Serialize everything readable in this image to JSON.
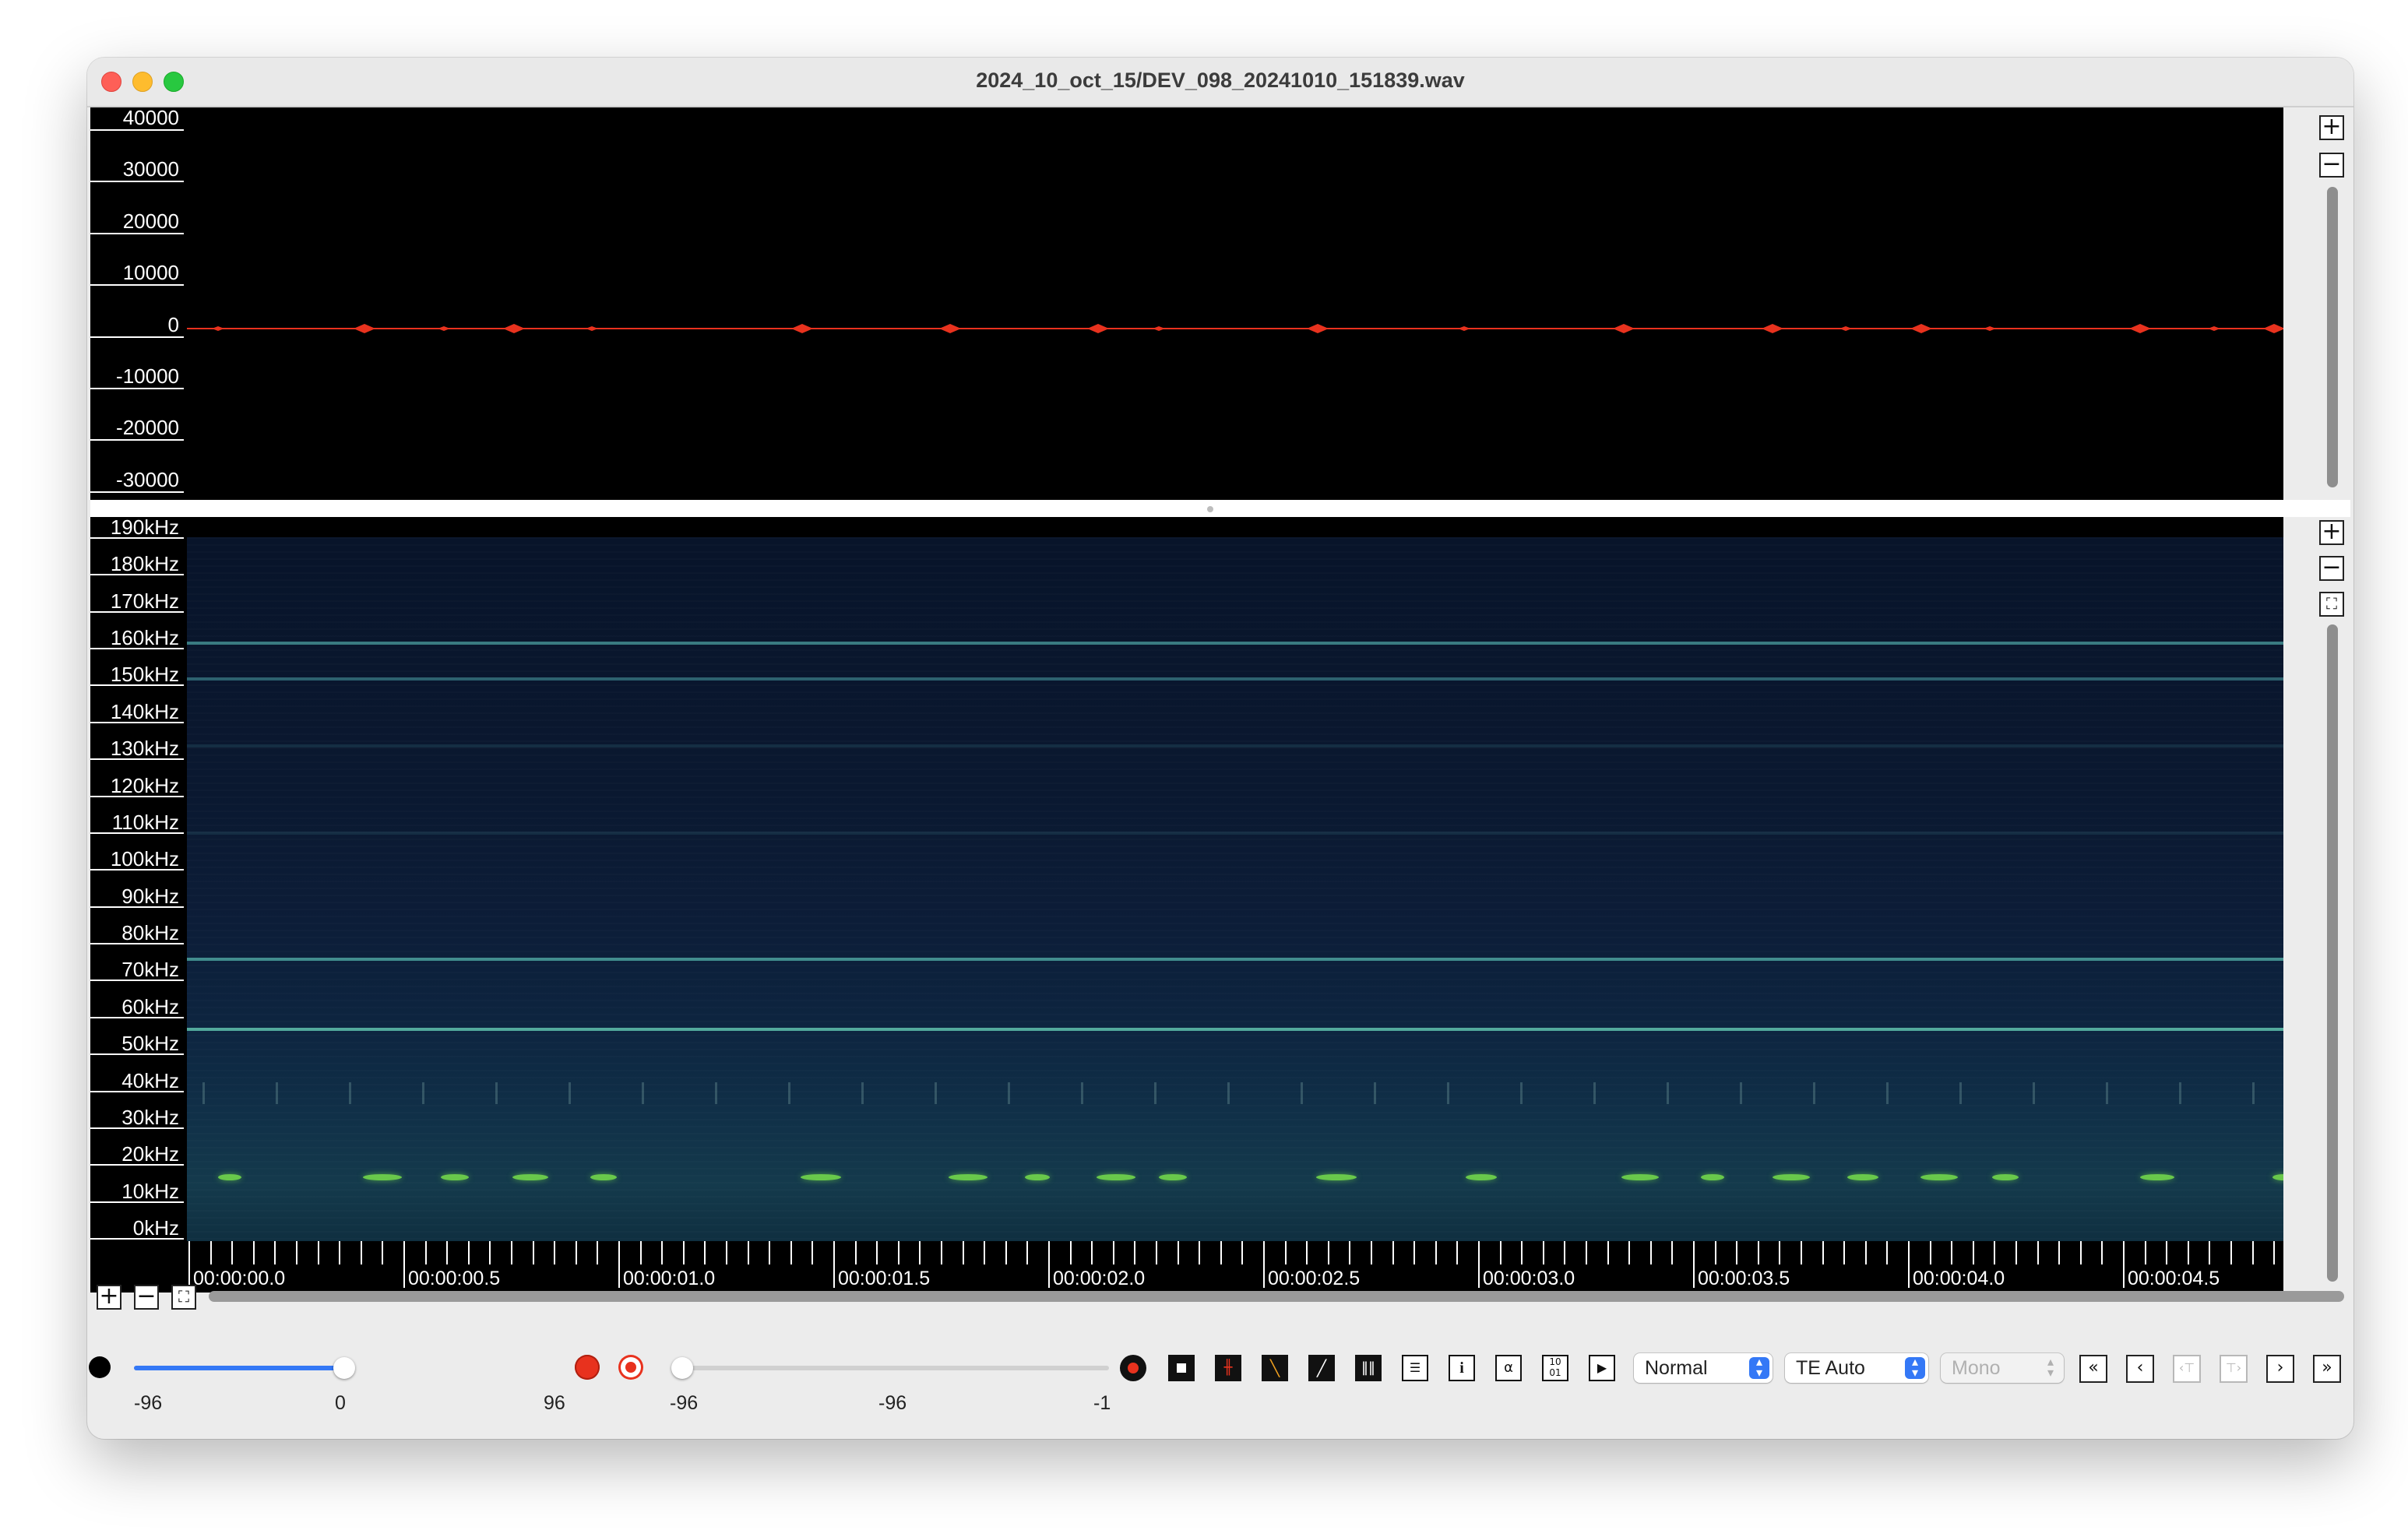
{
  "window": {
    "title": "2024_10_oct_15/DEV_098_20241010_151839.wav"
  },
  "waveform": {
    "y_labels": [
      "40000",
      "30000",
      "20000",
      "10000",
      "0",
      "-10000",
      "-20000",
      "-30000"
    ],
    "waveform_color": "#e8321e"
  },
  "spectrogram": {
    "freq_labels": [
      "190kHz",
      "180kHz",
      "170kHz",
      "160kHz",
      "150kHz",
      "140kHz",
      "130kHz",
      "120kHz",
      "110kHz",
      "100kHz",
      "90kHz",
      "80kHz",
      "70kHz",
      "60kHz",
      "50kHz",
      "40kHz",
      "30kHz",
      "20kHz",
      "10kHz",
      "0kHz"
    ],
    "time_labels": [
      "00:00:00.0",
      "00:00:00.5",
      "00:00:01.0",
      "00:00:01.5",
      "00:00:02.0",
      "00:00:02.5",
      "00:00:03.0",
      "00:00:03.5",
      "00:00:04.0",
      "00:00:04.5"
    ]
  },
  "side_buttons": {
    "zoom_in": "+",
    "zoom_out": "−",
    "zoom_fit": "⛶"
  },
  "transport": {
    "playback_gain": {
      "min_label": "-96",
      "mid_label": "0",
      "max_label": "96",
      "value": 0
    },
    "record_gain": {
      "min_label": "-96",
      "mid_label": "-96",
      "max_label": "-1",
      "value": -96
    },
    "mode_select": "Normal",
    "te_select": "TE Auto",
    "channel_select": "Mono",
    "accent_color": "#3478f6",
    "record_color": "#e8321e"
  }
}
